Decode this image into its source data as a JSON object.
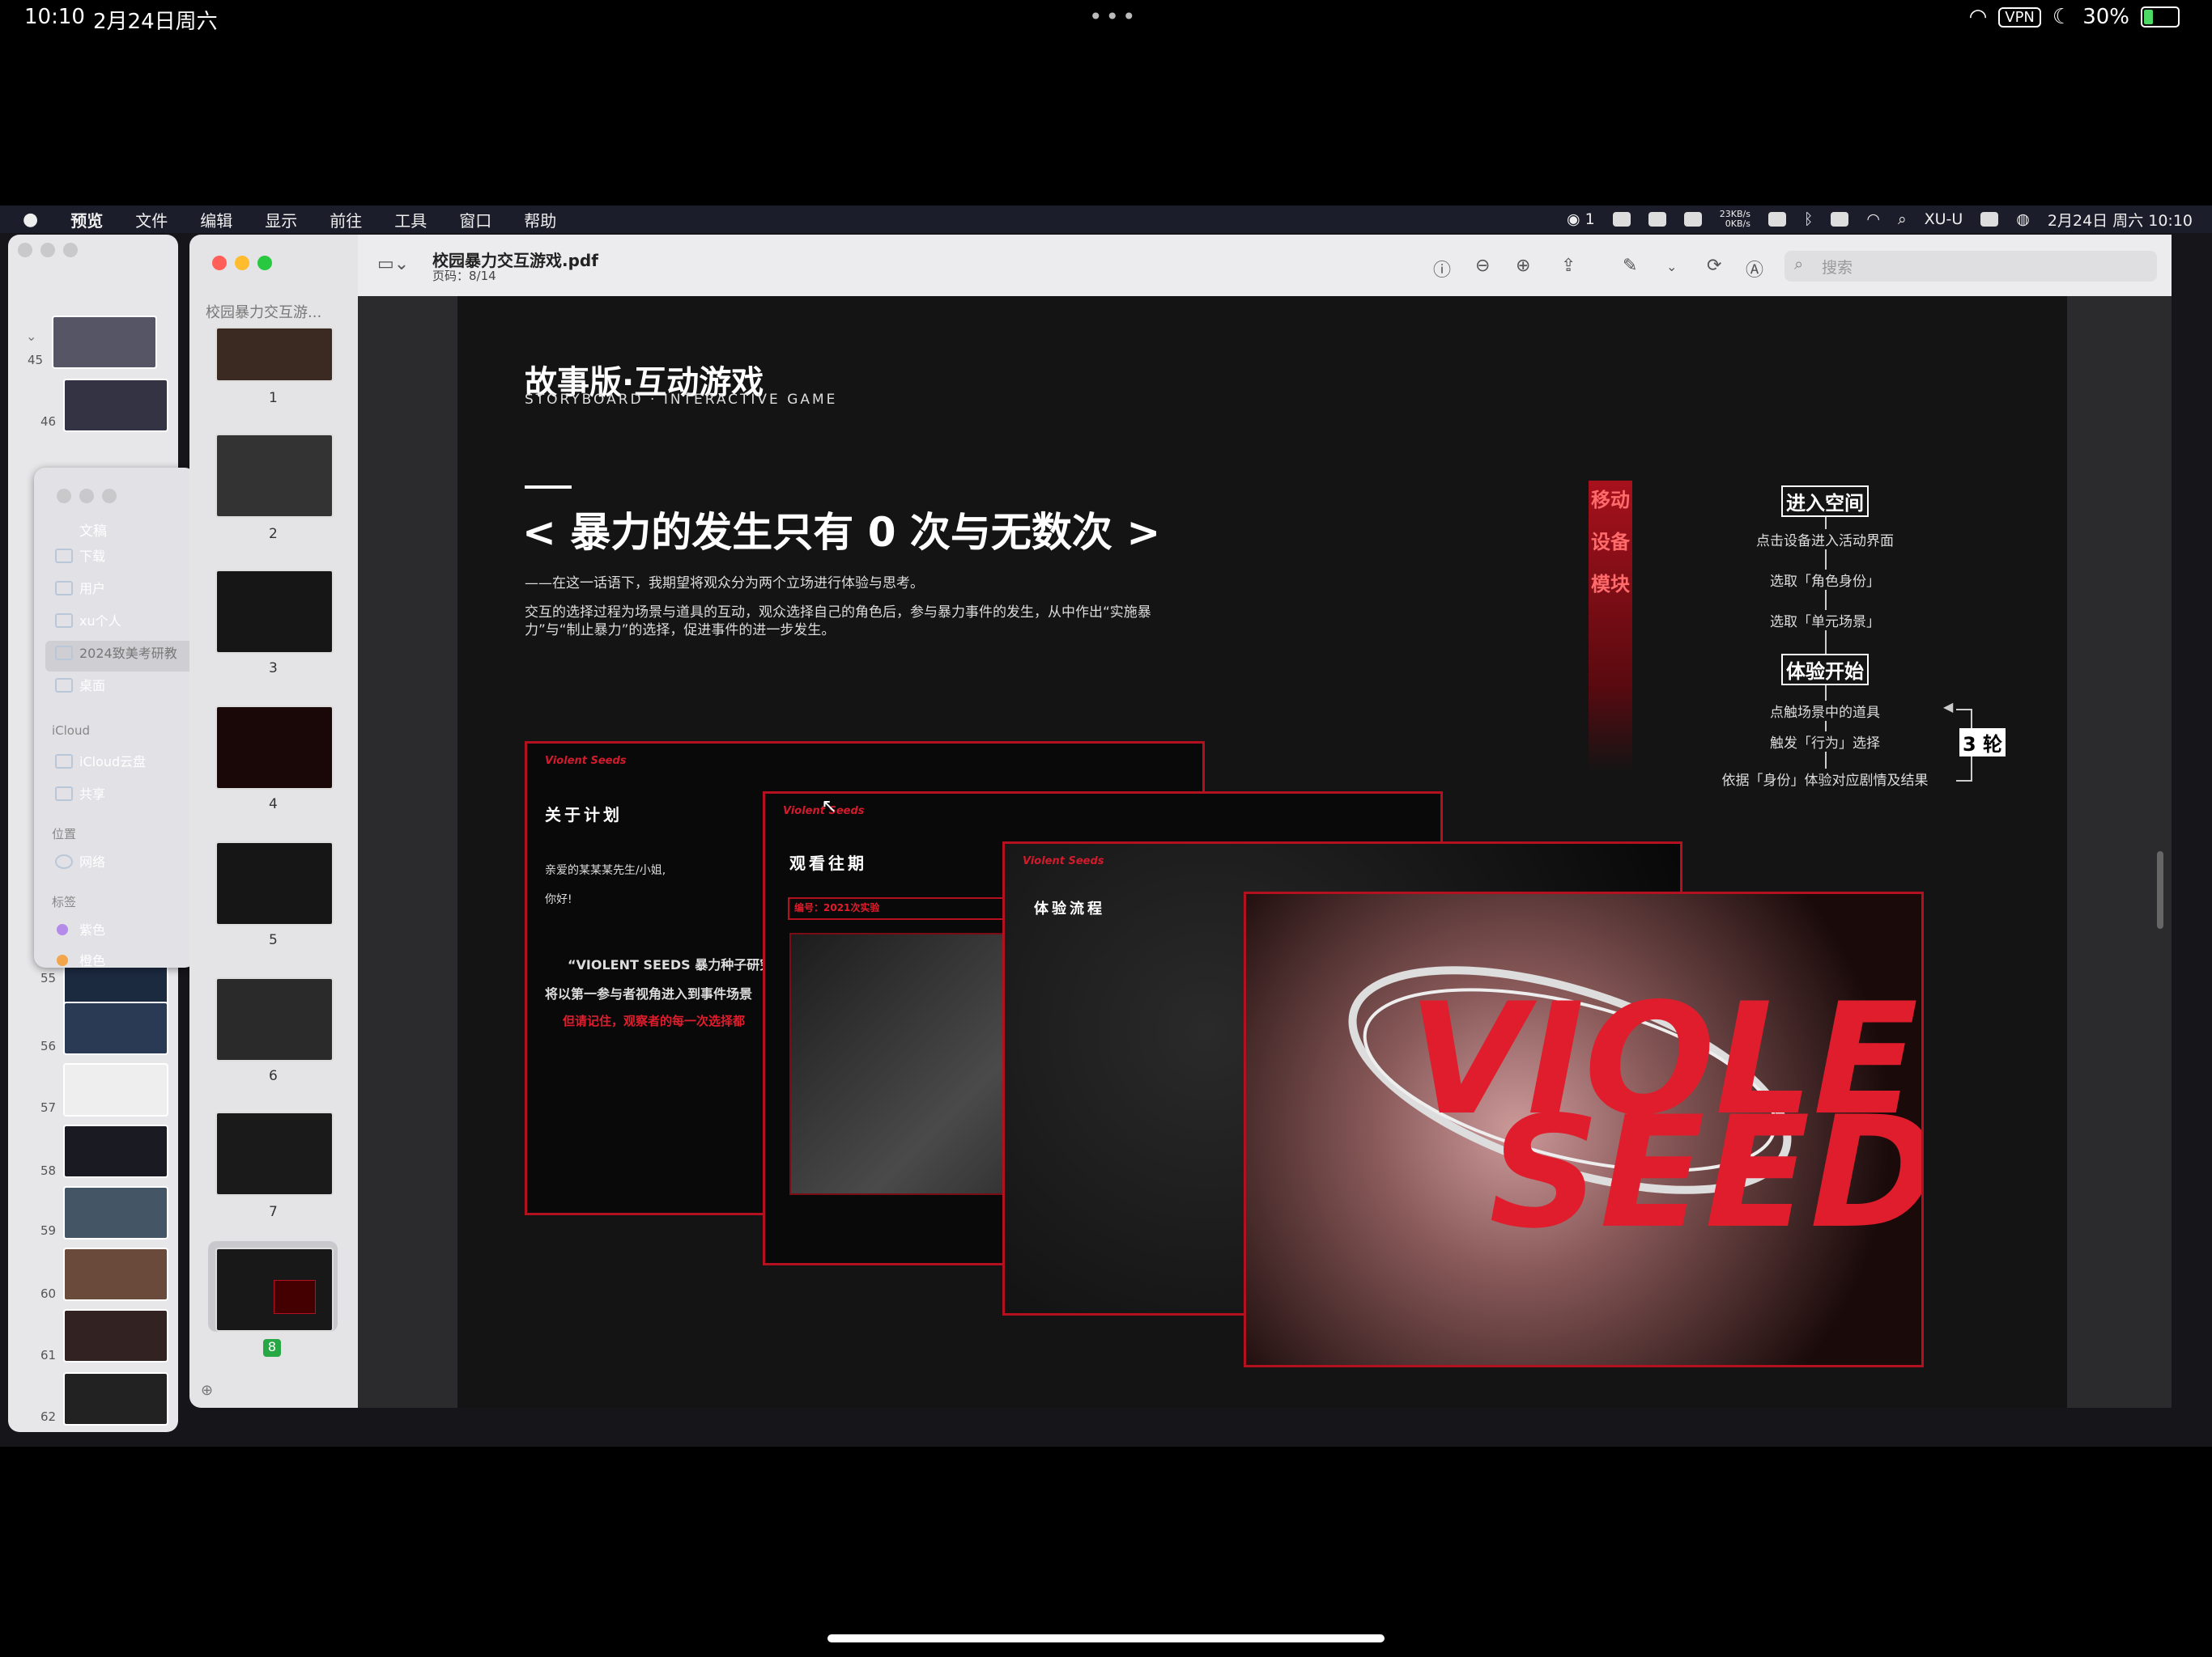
{
  "ipad": {
    "time": "10:10",
    "date": "2月24日周六",
    "vpn": "VPN",
    "battery": "30%",
    "battery_level": 0.3
  },
  "mac_menu": {
    "items": [
      "预览",
      "文件",
      "编辑",
      "显示",
      "前往",
      "工具",
      "窗口",
      "帮助"
    ],
    "right": {
      "wechat_count": "1",
      "net_up": "23KB/s",
      "net_down": "0KB/s",
      "user": "XU-U",
      "datetime": "2月24日 周六 10:10"
    }
  },
  "back_window": {
    "thumbs": [
      {
        "n": "45"
      },
      {
        "n": "46"
      },
      {
        "n": "55"
      },
      {
        "n": "56"
      },
      {
        "n": "57"
      },
      {
        "n": "58"
      },
      {
        "n": "59"
      },
      {
        "n": "60"
      },
      {
        "n": "61"
      },
      {
        "n": "62"
      }
    ]
  },
  "finder": {
    "items": [
      "文稿",
      "下载",
      "用户",
      "xu个人",
      "2024致美考研教",
      "桌面"
    ],
    "icloud_header": "iCloud",
    "icloud_items": [
      "iCloud云盘",
      "共享"
    ],
    "location_header": "位置",
    "location_items": [
      "网络"
    ],
    "tags_header": "标签",
    "tags": [
      {
        "label": "紫色",
        "color": "#b48be8"
      },
      {
        "label": "橙色",
        "color": "#f2a54a"
      }
    ]
  },
  "preview": {
    "filename": "校园暴力交互游戏.pdf",
    "page_info": "页码：8/14",
    "sidebar_title": "校园暴力交互游...",
    "search_placeholder": "搜索",
    "pages": [
      "1",
      "2",
      "3",
      "4",
      "5",
      "6",
      "7"
    ],
    "current_page": "8"
  },
  "slide": {
    "title_cn": "故事版·互动游戏",
    "title_en": "STORYBOARD · INTERACTIVE GAME",
    "headline": "< 暴力的发生只有 0 次与无数次 >",
    "para1": "——在这一话语下，我期望将观众分为两个立场进行体验与思考。",
    "para2": "交互的选择过程为场景与道具的互动，观众选择自己的角色后，参与暴力事件的发生，从中作出“实施暴力”与“制止暴力”的选择，促进事件的进一步发生。",
    "side_bar": [
      "移动",
      "设备",
      "模块"
    ],
    "flow": {
      "h1": "进入空间",
      "s1": [
        "点击设备进入活动界面",
        "选取「角色身份」",
        "选取「单元场景」"
      ],
      "h2": "体验开始",
      "s2": [
        "点触场景中的道具",
        "触发「行为」选择",
        "依据「身份」体验对应剧情及结果"
      ],
      "loop": "3 轮"
    },
    "card1": {
      "title": "关于计划",
      "greet": "亲爱的某某某先生/小姐,",
      "hello": "你好!",
      "quote": "“VIOLENT SEEDS 暴力种子研究",
      "line2": "将以第一参与者视角进入到事件场景",
      "red": "但请记住，观察者的每一次选择都"
    },
    "card2": {
      "title": "观看往期",
      "badge": "编号：2021次实验"
    },
    "card3": {
      "title": "体验流程"
    },
    "card4": {
      "word1": "VIOLEN",
      "word2": "SEED"
    },
    "logo": "Violent Seeds"
  }
}
